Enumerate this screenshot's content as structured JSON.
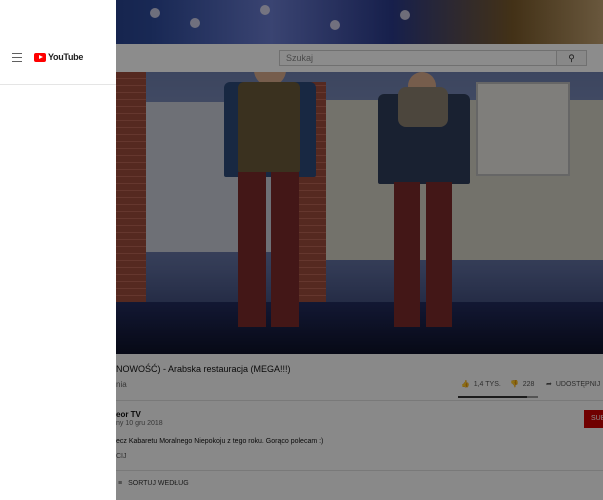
{
  "masthead": {
    "logo_text": "YouTube",
    "search_placeholder": "Szukaj",
    "search_icon": "search-icon"
  },
  "video": {
    "title": "NOWOŚĆ) - Arabska restauracja (MEGA!!!)",
    "views_text": "nia",
    "likes": "1,4 TYS.",
    "dislikes": "228",
    "share_label": "UDOSTĘPNIJ",
    "like_ratio": 0.86
  },
  "channel": {
    "name": "eor TV",
    "date": "ny 10 gru 2018",
    "subscribe_label": "SUB"
  },
  "description": {
    "text": "ecz Kabaretu Moralnego Niepokoju z tego roku. Gorąco polecam :)",
    "more_label": "CIJ"
  },
  "comments": {
    "sort_label": "SORTUJ WEDŁUG"
  },
  "colors": {
    "brand_red": "#ff0000",
    "subscribe_red": "#cc0000"
  }
}
